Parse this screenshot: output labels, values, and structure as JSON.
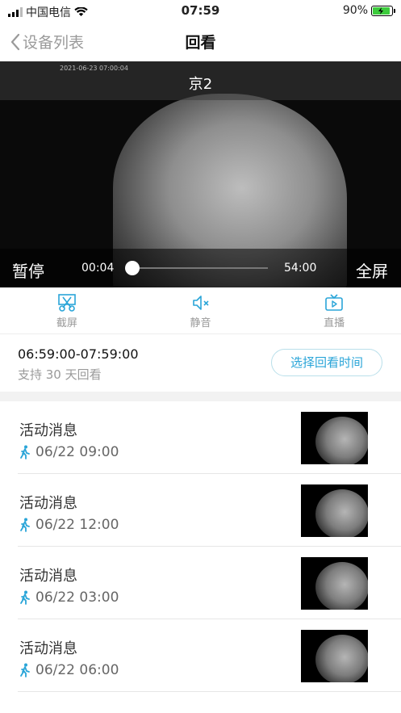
{
  "status": {
    "carrier": "中国电信",
    "time": "07:59",
    "battery": "90%",
    "battery_level": 0.9
  },
  "nav": {
    "back_label": "设备列表",
    "title": "回看"
  },
  "video": {
    "timestamp": "2021-06-23 07:00:04",
    "camera_name": "京2",
    "pause_label": "暂停",
    "current_time": "00:04",
    "total_time": "54:00",
    "progress": 0.0,
    "fullscreen_label": "全屏"
  },
  "tools": [
    {
      "label": "截屏",
      "icon": "screenshot-icon"
    },
    {
      "label": "静音",
      "icon": "mute-icon"
    },
    {
      "label": "直播",
      "icon": "live-tv-icon"
    }
  ],
  "range": {
    "time": "06:59:00-07:59:00",
    "subtitle": "支持 30 天回看",
    "button": "选择回看时间"
  },
  "colors": {
    "accent": "#2aa5d8",
    "battery_green": "#3ccb3c"
  },
  "events": [
    {
      "title": "活动消息",
      "time": "06/22 09:00",
      "icon": "walking-person-icon"
    },
    {
      "title": "活动消息",
      "time": "06/22 12:00",
      "icon": "walking-person-icon"
    },
    {
      "title": "活动消息",
      "time": "06/22 03:00",
      "icon": "walking-person-icon"
    },
    {
      "title": "活动消息",
      "time": "06/22 06:00",
      "icon": "walking-person-icon"
    }
  ]
}
